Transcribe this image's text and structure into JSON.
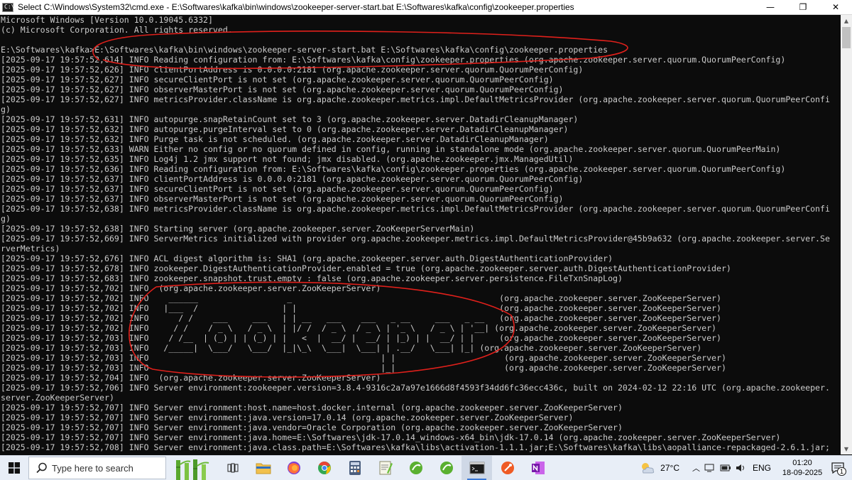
{
  "window": {
    "title": "Select C:\\Windows\\System32\\cmd.exe - E:\\Softwares\\kafka\\bin\\windows\\zookeeper-server-start.bat  E:\\Softwares\\kafka\\config\\zookeeper.properties",
    "icon_text": "C:\\",
    "minimize_glyph": "—",
    "maximize_glyph": "❐",
    "close_glyph": "✕"
  },
  "console": {
    "lines": [
      "Microsoft Windows [Version 10.0.19045.6332]",
      "(c) Microsoft Corporation. All rights reserved.",
      "",
      "E:\\Softwares\\kafka>E:\\Softwares\\kafka\\bin\\windows\\zookeeper-server-start.bat E:\\Softwares\\kafka\\config\\zookeeper.properties",
      "[2025-09-17 19:57:52,614] INFO Reading configuration from: E:\\Softwares\\kafka\\config\\zookeeper.properties (org.apache.zookeeper.server.quorum.QuorumPeerConfig)",
      "[2025-09-17 19:57:52,626] INFO clientPortAddress is 0.0.0.0:2181 (org.apache.zookeeper.server.quorum.QuorumPeerConfig)",
      "[2025-09-17 19:57:52,627] INFO secureClientPort is not set (org.apache.zookeeper.server.quorum.QuorumPeerConfig)",
      "[2025-09-17 19:57:52,627] INFO observerMasterPort is not set (org.apache.zookeeper.server.quorum.QuorumPeerConfig)",
      "[2025-09-17 19:57:52,627] INFO metricsProvider.className is org.apache.zookeeper.metrics.impl.DefaultMetricsProvider (org.apache.zookeeper.server.quorum.QuorumPeerConfi",
      "g)",
      "[2025-09-17 19:57:52,631] INFO autopurge.snapRetainCount set to 3 (org.apache.zookeeper.server.DatadirCleanupManager)",
      "[2025-09-17 19:57:52,632] INFO autopurge.purgeInterval set to 0 (org.apache.zookeeper.server.DatadirCleanupManager)",
      "[2025-09-17 19:57:52,632] INFO Purge task is not scheduled. (org.apache.zookeeper.server.DatadirCleanupManager)",
      "[2025-09-17 19:57:52,633] WARN Either no config or no quorum defined in config, running in standalone mode (org.apache.zookeeper.server.quorum.QuorumPeerMain)",
      "[2025-09-17 19:57:52,635] INFO Log4j 1.2 jmx support not found; jmx disabled. (org.apache.zookeeper.jmx.ManagedUtil)",
      "[2025-09-17 19:57:52,636] INFO Reading configuration from: E:\\Softwares\\kafka\\config\\zookeeper.properties (org.apache.zookeeper.server.quorum.QuorumPeerConfig)",
      "[2025-09-17 19:57:52,637] INFO clientPortAddress is 0.0.0.0:2181 (org.apache.zookeeper.server.quorum.QuorumPeerConfig)",
      "[2025-09-17 19:57:52,637] INFO secureClientPort is not set (org.apache.zookeeper.server.quorum.QuorumPeerConfig)",
      "[2025-09-17 19:57:52,637] INFO observerMasterPort is not set (org.apache.zookeeper.server.quorum.QuorumPeerConfig)",
      "[2025-09-17 19:57:52,638] INFO metricsProvider.className is org.apache.zookeeper.metrics.impl.DefaultMetricsProvider (org.apache.zookeeper.server.quorum.QuorumPeerConfi",
      "g)",
      "[2025-09-17 19:57:52,638] INFO Starting server (org.apache.zookeeper.server.ZooKeeperServerMain)",
      "[2025-09-17 19:57:52,669] INFO ServerMetrics initialized with provider org.apache.zookeeper.metrics.impl.DefaultMetricsProvider@45b9a632 (org.apache.zookeeper.server.Se",
      "rverMetrics)",
      "[2025-09-17 19:57:52,676] INFO ACL digest algorithm is: SHA1 (org.apache.zookeeper.server.auth.DigestAuthenticationProvider)",
      "[2025-09-17 19:57:52,678] INFO zookeeper.DigestAuthenticationProvider.enabled = true (org.apache.zookeeper.server.auth.DigestAuthenticationProvider)",
      "[2025-09-17 19:57:52,683] INFO zookeeper.snapshot.trust.empty : false (org.apache.zookeeper.server.persistence.FileTxnSnapLog)",
      "[2025-09-17 19:57:52,702] INFO  (org.apache.zookeeper.server.ZooKeeperServer)",
      "[2025-09-17 19:57:52,702] INFO    ______                  _                                          (org.apache.zookeeper.server.ZooKeeperServer)",
      "[2025-09-17 19:57:52,702] INFO   |___  /                 | |                                         (org.apache.zookeeper.server.ZooKeeperServer)",
      "[2025-09-17 19:57:52,702] INFO      / /    ___     ___   | | __   ___    ___   _ __     ___   _ __   (org.apache.zookeeper.server.ZooKeeperServer)",
      "[2025-09-17 19:57:52,702] INFO     / /    / _ \\   / _ \\  | |/ /  / _ \\  / _ \\ | '_ \\   / _ \\ | '__| (org.apache.zookeeper.server.ZooKeeperServer)",
      "[2025-09-17 19:57:52,703] INFO    / /__  | (_) | | (_) | |   <  |  __/ |  __/ | |_) | |  __/ | |     (org.apache.zookeeper.server.ZooKeeperServer)",
      "[2025-09-17 19:57:52,703] INFO   /_____|  \\___/   \\___/  |_|\\_\\  \\___|  \\___| | .__/   \\___| |_| (org.apache.zookeeper.server.ZooKeeperServer)",
      "[2025-09-17 19:57:52,703] INFO                                               | |                      (org.apache.zookeeper.server.ZooKeeperServer)",
      "[2025-09-17 19:57:52,703] INFO                                               |_|                      (org.apache.zookeeper.server.ZooKeeperServer)",
      "[2025-09-17 19:57:52,704] INFO  (org.apache.zookeeper.server.ZooKeeperServer)",
      "[2025-09-17 19:57:52,706] INFO Server environment:zookeeper.version=3.8.4-9316c2a7a97e1666d8f4593f34dd6fc36ecc436c, built on 2024-02-12 22:16 UTC (org.apache.zookeeper.",
      "server.ZooKeeperServer)",
      "[2025-09-17 19:57:52,707] INFO Server environment:host.name=host.docker.internal (org.apache.zookeeper.server.ZooKeeperServer)",
      "[2025-09-17 19:57:52,707] INFO Server environment:java.version=17.0.14 (org.apache.zookeeper.server.ZooKeeperServer)",
      "[2025-09-17 19:57:52,707] INFO Server environment:java.vendor=Oracle Corporation (org.apache.zookeeper.server.ZooKeeperServer)",
      "[2025-09-17 19:57:52,707] INFO Server environment:java.home=E:\\Softwares\\jdk-17.0.14_windows-x64_bin\\jdk-17.0.14 (org.apache.zookeeper.server.ZooKeeperServer)",
      "[2025-09-17 19:57:52,708] INFO Server environment:java.class.path=E:\\Softwares\\kafka\\libs\\activation-1.1.1.jar;E:\\Softwares\\kafka\\libs\\aopalliance-repackaged-2.6.1.jar;"
    ]
  },
  "scrollbar": {
    "up_glyph": "▲",
    "down_glyph": "▼"
  },
  "annotation": {
    "color": "#e0201b"
  },
  "taskbar": {
    "search_placeholder": "Type here to search",
    "apps": [
      "task-view",
      "file-explorer",
      "firefox",
      "chrome",
      "calculator",
      "notepad-plus",
      "gecko-app-1",
      "gecko-app-2",
      "command-prompt",
      "postman",
      "onenote"
    ],
    "weather": "27°C",
    "language": "ENG",
    "time": "01:20",
    "date": "18-09-2025",
    "notification_count": "1"
  }
}
